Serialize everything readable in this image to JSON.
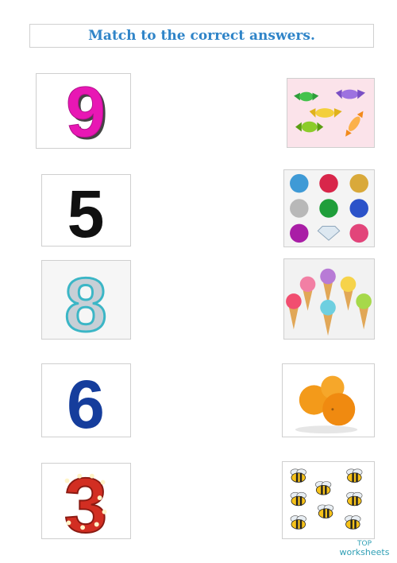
{
  "title": "Match to the correct answers.",
  "numbers": [
    {
      "value": "9",
      "color": "#e817b4"
    },
    {
      "value": "5",
      "color": "#111111"
    },
    {
      "value": "8",
      "color": "#3bb6c6"
    },
    {
      "value": "6",
      "color": "#153d9c"
    },
    {
      "value": "3",
      "color": "#d22e22"
    }
  ],
  "pictures": [
    {
      "name": "candies",
      "count": 5
    },
    {
      "name": "gems",
      "count": 9
    },
    {
      "name": "ice-creams",
      "count": 6
    },
    {
      "name": "oranges",
      "count": 3
    },
    {
      "name": "bees",
      "count": 8
    }
  ],
  "brand": {
    "line1": "TOP",
    "line2": "worksheets",
    "color": "#2f9fb5"
  }
}
